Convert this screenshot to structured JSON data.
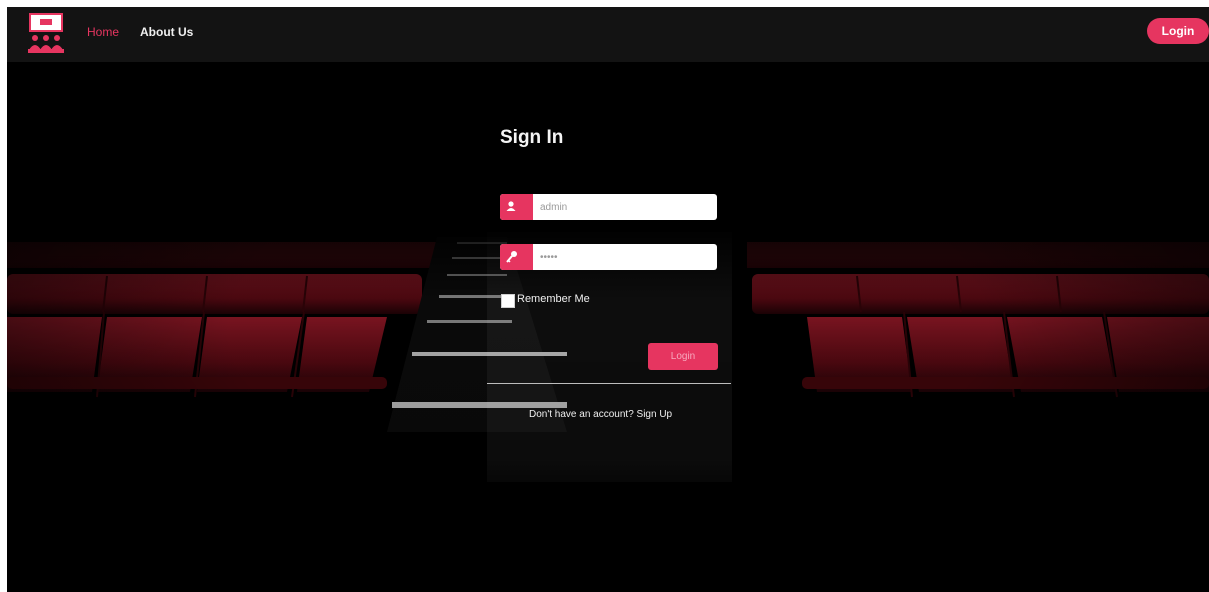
{
  "navbar": {
    "logo_icon": "cinema-logo-icon",
    "home_label": "Home",
    "about_label": "About Us",
    "login_label": "Login"
  },
  "signin": {
    "title": "Sign In",
    "username_value": "admin",
    "password_value": "•••••",
    "user_icon": "user-icon",
    "key_icon": "key-icon",
    "remember_label": "Remember Me",
    "remember_checked": false,
    "submit_label": "Login",
    "signup_text": "Don't have an account? Sign Up"
  },
  "colors": {
    "accent": "#e63560",
    "navbar_bg": "#131313",
    "page_bg": "#000000",
    "seat_red": "#6a0d16"
  }
}
